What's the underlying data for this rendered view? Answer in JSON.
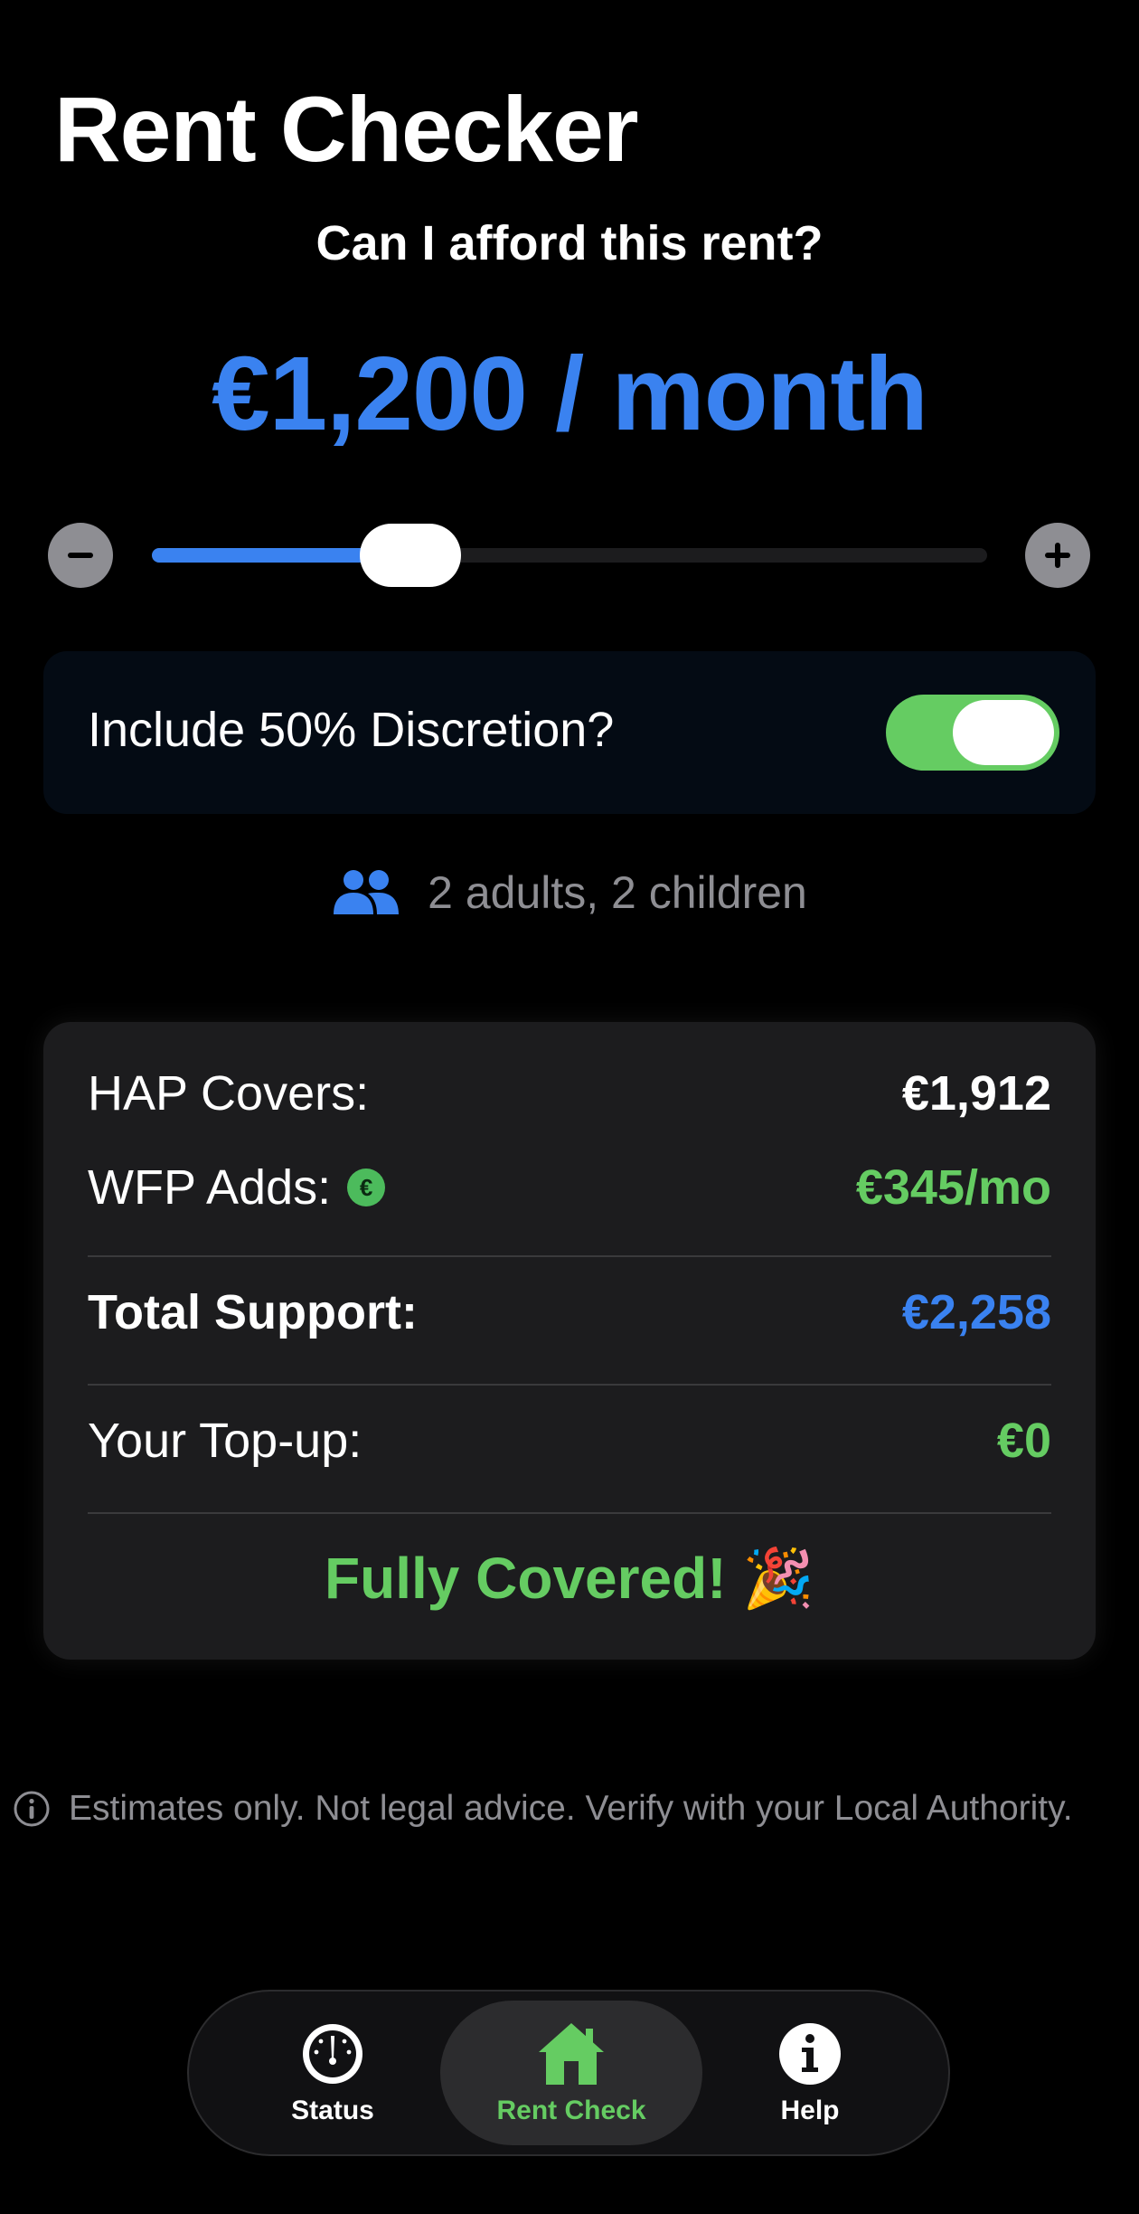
{
  "header": {
    "title": "Rent Checker",
    "subtitle": "Can I afford this rent?"
  },
  "rent": {
    "amount_label": "€1,200 / month",
    "slider_fraction": 0.31
  },
  "discretion": {
    "label": "Include 50% Discretion?",
    "enabled": true
  },
  "household": {
    "icon": "people-icon",
    "label": "2 adults, 2 children"
  },
  "results": {
    "hap_label": "HAP Covers:",
    "hap_value": "€1,912",
    "wfp_label": "WFP Adds:",
    "wfp_badge": "€",
    "wfp_value": "€345/mo",
    "total_label": "Total Support:",
    "total_value": "€2,258",
    "topup_label": "Your Top-up:",
    "topup_value": "€0",
    "status": "Fully Covered! 🎉"
  },
  "disclaimer": {
    "icon": "info-circle-icon",
    "text": "Estimates only. Not legal advice. Verify with your Local Authority."
  },
  "tabs": [
    {
      "label": "Status",
      "icon": "gauge-icon",
      "active": false
    },
    {
      "label": "Rent Check",
      "icon": "house-icon",
      "active": true
    },
    {
      "label": "Help",
      "icon": "info-icon",
      "active": false
    }
  ],
  "colors": {
    "accent_blue": "#3a82f0",
    "accent_green": "#65cc62",
    "card_bg": "#1c1c1e"
  }
}
